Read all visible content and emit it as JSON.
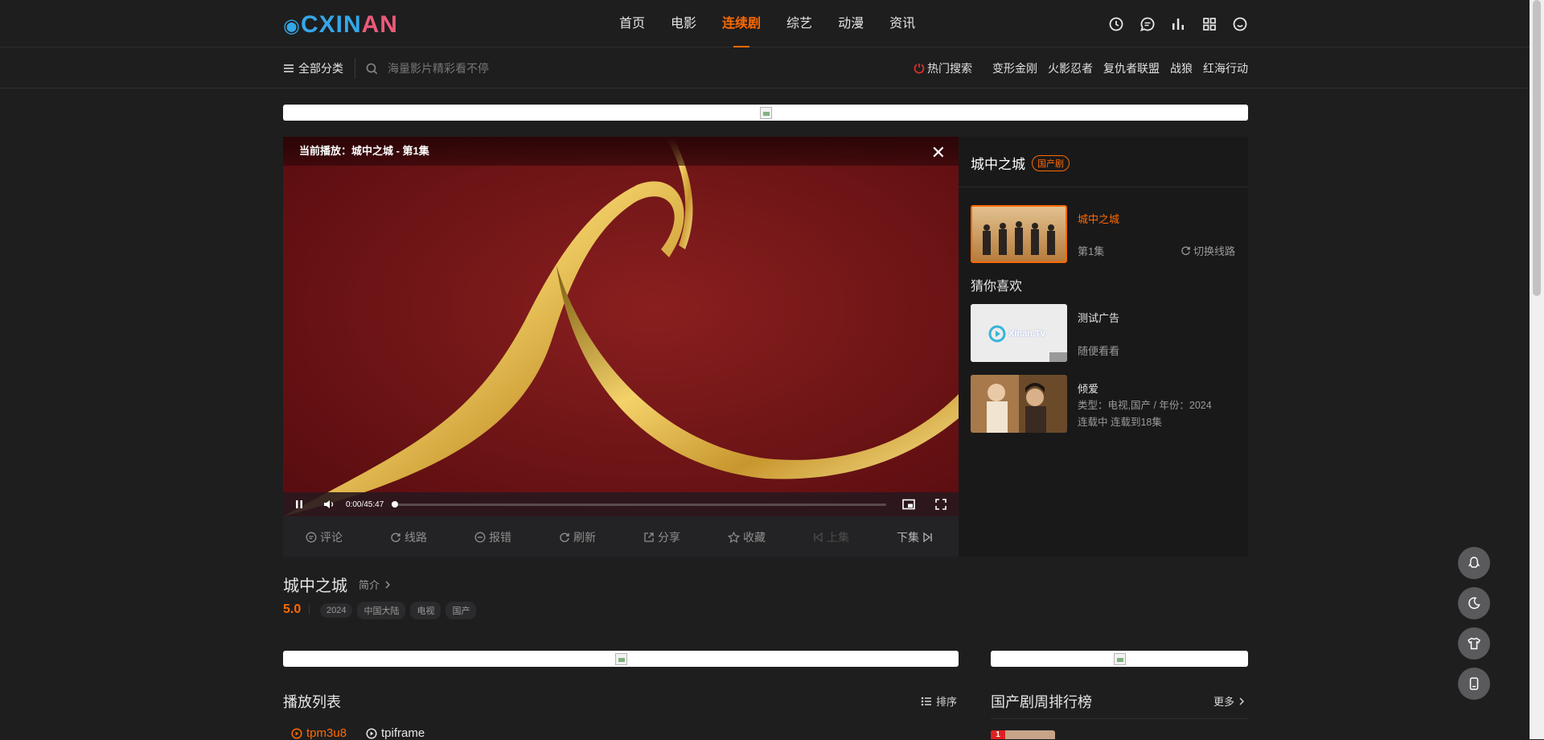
{
  "logo": {
    "part1": "CXIN",
    "part2": "AN"
  },
  "nav": [
    "首页",
    "电影",
    "连续剧",
    "综艺",
    "动漫",
    "资讯"
  ],
  "nav_active": 2,
  "header_icons": [
    "history-icon",
    "message-icon",
    "chart-icon",
    "grid-icon",
    "user-icon"
  ],
  "subnav": {
    "all_categories": "全部分类",
    "search_placeholder": "海量影片精彩看不停"
  },
  "hot_search": {
    "label": "热门搜索",
    "keywords": [
      "变形金刚",
      "火影忍者",
      "复仇者联盟",
      "战狼",
      "红海行动"
    ]
  },
  "player": {
    "now_playing": "当前播放：城中之城 - 第1集",
    "time": "0:00/45:47",
    "progress": 0.0
  },
  "actions": [
    "评论",
    "线路",
    "报错",
    "刷新",
    "分享",
    "收藏",
    "上集",
    "下集"
  ],
  "right_panel": {
    "title": "城中之城",
    "badge": "国产剧",
    "current": {
      "name": "城中之城",
      "episode": "第1集",
      "switch": "切换线路"
    },
    "guess_title": "猜你喜欢",
    "ad": {
      "name": "测试广告",
      "sub": "随便看看",
      "thumb_text": "Xinan.Tv"
    },
    "rec": {
      "name": "倾爱",
      "type": "类型：电视,国产 / 年份：2024",
      "status": "连载中 连载到18集"
    }
  },
  "info": {
    "title": "城中之城",
    "intro": "简介",
    "score": "5.0",
    "tags": [
      "2024",
      "中国大陆",
      "电视",
      "国产"
    ]
  },
  "playlist": {
    "title": "播放列表",
    "sort": "排序",
    "sources": [
      "tpm3u8",
      "tpiframe"
    ]
  },
  "ranking": {
    "title": "国产剧周排行榜",
    "more": "更多",
    "first_rank": "1"
  },
  "colors": {
    "accent": "#ff6a00",
    "bg": "#1e1e1f",
    "logo_blue": "#35a6e8",
    "logo_pink": "#eb5a78"
  }
}
